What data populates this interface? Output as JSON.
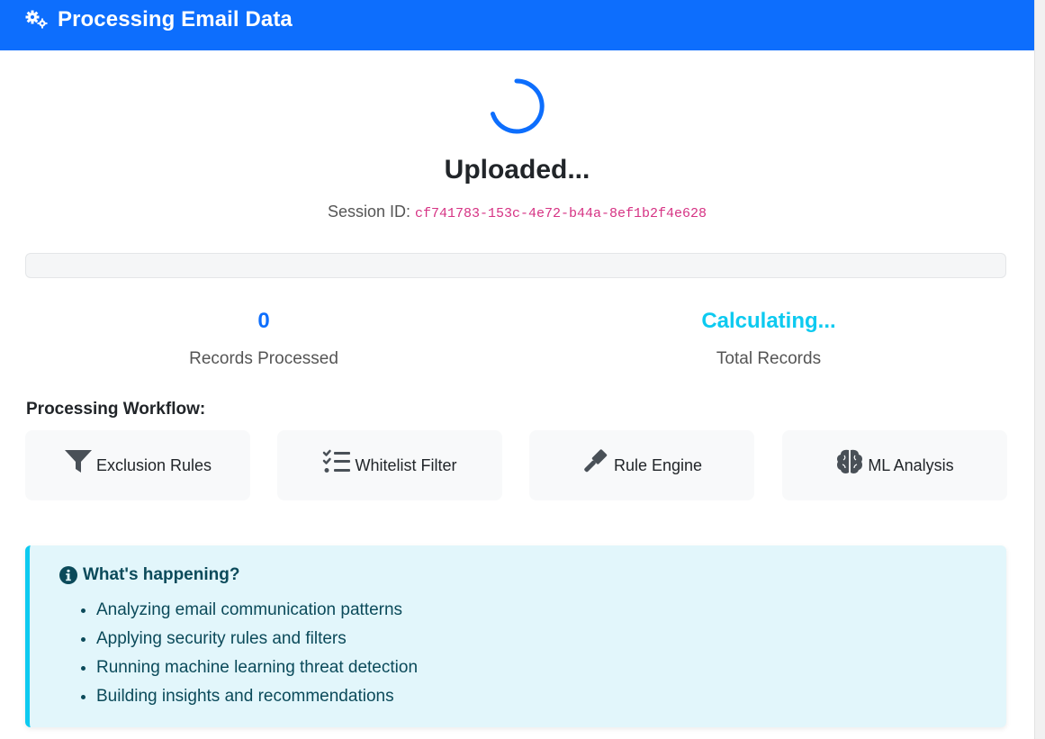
{
  "header": {
    "title": "Processing Email Data",
    "icon": "gears-icon"
  },
  "status": {
    "title": "Uploaded...",
    "session_label": "Session ID:",
    "session_id": "cf741783-153c-4e72-b44a-8ef1b2f4e628",
    "progress_fraction": 0
  },
  "stats": {
    "processed": {
      "value": "0",
      "label": "Records Processed"
    },
    "total": {
      "value": "Calculating...",
      "label": "Total Records"
    }
  },
  "workflow": {
    "heading": "Processing Workflow:",
    "steps": [
      {
        "label": "Exclusion Rules",
        "icon": "filter-icon"
      },
      {
        "label": "Whitelist Filter",
        "icon": "list-check-icon"
      },
      {
        "label": "Rule Engine",
        "icon": "gavel-icon"
      },
      {
        "label": "ML Analysis",
        "icon": "brain-icon"
      }
    ]
  },
  "info": {
    "heading": "What's happening?",
    "items": [
      "Analyzing email communication patterns",
      "Applying security rules and filters",
      "Running machine learning threat detection",
      "Building insights and recommendations"
    ]
  },
  "colors": {
    "primary": "#0d6efd",
    "info": "#0dcaf0",
    "code": "#d63384"
  }
}
